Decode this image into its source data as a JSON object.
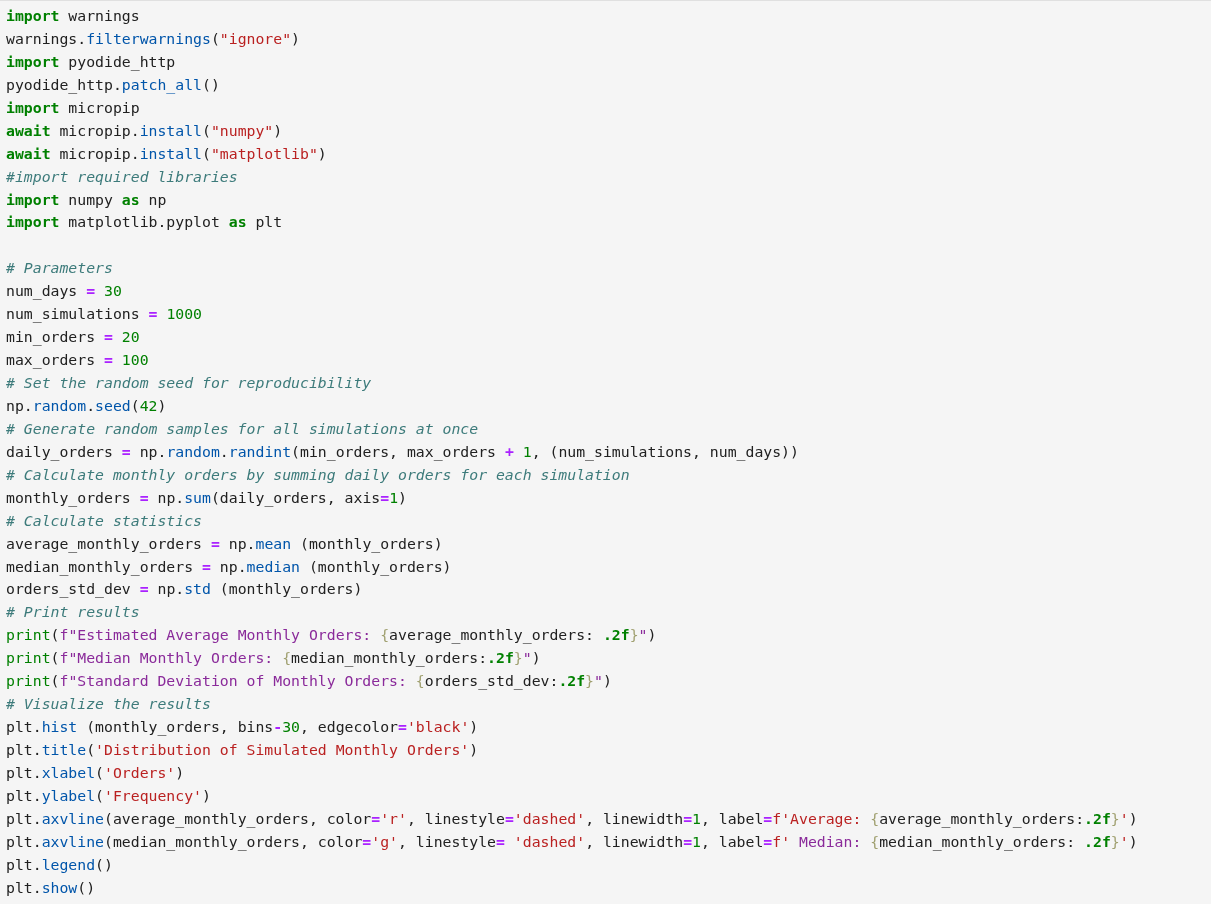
{
  "code_cell": {
    "lines": [
      {
        "kind": "code",
        "tokens": [
          {
            "kind": "kw",
            "text": "import"
          },
          {
            "kind": "name",
            "text": " warnings"
          }
        ]
      },
      {
        "kind": "code",
        "tokens": [
          {
            "kind": "name",
            "text": "warnings."
          },
          {
            "kind": "fn",
            "text": "filterwarnings"
          },
          {
            "kind": "name",
            "text": "("
          },
          {
            "kind": "str",
            "text": "\"ignore\""
          },
          {
            "kind": "name",
            "text": ")"
          }
        ]
      },
      {
        "kind": "code",
        "tokens": [
          {
            "kind": "kw",
            "text": "import"
          },
          {
            "kind": "name",
            "text": " pyodide_http"
          }
        ]
      },
      {
        "kind": "code",
        "tokens": [
          {
            "kind": "name",
            "text": "pyodide_http."
          },
          {
            "kind": "fn",
            "text": "patch_all"
          },
          {
            "kind": "name",
            "text": "()"
          }
        ]
      },
      {
        "kind": "code",
        "tokens": [
          {
            "kind": "kw",
            "text": "import"
          },
          {
            "kind": "name",
            "text": " micropip"
          }
        ]
      },
      {
        "kind": "code",
        "tokens": [
          {
            "kind": "kw",
            "text": "await"
          },
          {
            "kind": "name",
            "text": " micropip."
          },
          {
            "kind": "fn",
            "text": "install"
          },
          {
            "kind": "name",
            "text": "("
          },
          {
            "kind": "str",
            "text": "\"numpy\""
          },
          {
            "kind": "name",
            "text": ")"
          }
        ]
      },
      {
        "kind": "code",
        "tokens": [
          {
            "kind": "kw",
            "text": "await"
          },
          {
            "kind": "name",
            "text": " micropip."
          },
          {
            "kind": "fn",
            "text": "install"
          },
          {
            "kind": "name",
            "text": "("
          },
          {
            "kind": "str",
            "text": "\"matplotlib\""
          },
          {
            "kind": "name",
            "text": ")"
          }
        ]
      },
      {
        "kind": "code",
        "tokens": [
          {
            "kind": "com",
            "text": "#import required libraries"
          }
        ]
      },
      {
        "kind": "code",
        "tokens": [
          {
            "kind": "kw",
            "text": "import"
          },
          {
            "kind": "name",
            "text": " numpy "
          },
          {
            "kind": "kw",
            "text": "as"
          },
          {
            "kind": "name",
            "text": " np"
          }
        ]
      },
      {
        "kind": "code",
        "tokens": [
          {
            "kind": "kw",
            "text": "import"
          },
          {
            "kind": "name",
            "text": " matplotlib.pyplot "
          },
          {
            "kind": "kw",
            "text": "as"
          },
          {
            "kind": "name",
            "text": " plt"
          }
        ]
      },
      {
        "kind": "blank"
      },
      {
        "kind": "code",
        "tokens": [
          {
            "kind": "com",
            "text": "# Parameters"
          }
        ]
      },
      {
        "kind": "code",
        "tokens": [
          {
            "kind": "name",
            "text": "num_days "
          },
          {
            "kind": "op",
            "text": "="
          },
          {
            "kind": "num",
            "text": " 30"
          }
        ]
      },
      {
        "kind": "code",
        "tokens": [
          {
            "kind": "name",
            "text": "num_simulations "
          },
          {
            "kind": "op",
            "text": "="
          },
          {
            "kind": "num",
            "text": " 1000"
          }
        ]
      },
      {
        "kind": "code",
        "tokens": [
          {
            "kind": "name",
            "text": "min_orders "
          },
          {
            "kind": "op",
            "text": "="
          },
          {
            "kind": "num",
            "text": " 20"
          }
        ]
      },
      {
        "kind": "code",
        "tokens": [
          {
            "kind": "name",
            "text": "max_orders "
          },
          {
            "kind": "op",
            "text": "="
          },
          {
            "kind": "num",
            "text": " 100"
          }
        ]
      },
      {
        "kind": "code",
        "tokens": [
          {
            "kind": "com",
            "text": "# Set the random seed for reproducibility"
          }
        ]
      },
      {
        "kind": "code",
        "tokens": [
          {
            "kind": "name",
            "text": "np."
          },
          {
            "kind": "fn",
            "text": "random"
          },
          {
            "kind": "name",
            "text": "."
          },
          {
            "kind": "fn",
            "text": "seed"
          },
          {
            "kind": "name",
            "text": "("
          },
          {
            "kind": "num",
            "text": "42"
          },
          {
            "kind": "name",
            "text": ")"
          }
        ]
      },
      {
        "kind": "code",
        "tokens": [
          {
            "kind": "com",
            "text": "# Generate random samples for all simulations at once"
          }
        ]
      },
      {
        "kind": "code",
        "tokens": [
          {
            "kind": "name",
            "text": "daily_orders "
          },
          {
            "kind": "op",
            "text": "="
          },
          {
            "kind": "name",
            "text": " np."
          },
          {
            "kind": "fn",
            "text": "random"
          },
          {
            "kind": "name",
            "text": "."
          },
          {
            "kind": "fn",
            "text": "randint"
          },
          {
            "kind": "name",
            "text": "(min_orders, max_orders "
          },
          {
            "kind": "op",
            "text": "+"
          },
          {
            "kind": "num",
            "text": " 1"
          },
          {
            "kind": "name",
            "text": ", (num_simulations, num_days))"
          }
        ]
      },
      {
        "kind": "code",
        "tokens": [
          {
            "kind": "com",
            "text": "# Calculate monthly orders by summing daily orders for each simulation"
          }
        ]
      },
      {
        "kind": "code",
        "tokens": [
          {
            "kind": "name",
            "text": "monthly_orders "
          },
          {
            "kind": "op",
            "text": "="
          },
          {
            "kind": "name",
            "text": " np."
          },
          {
            "kind": "fn",
            "text": "sum"
          },
          {
            "kind": "name",
            "text": "(daily_orders, axis"
          },
          {
            "kind": "op",
            "text": "="
          },
          {
            "kind": "num",
            "text": "1"
          },
          {
            "kind": "name",
            "text": ")"
          }
        ]
      },
      {
        "kind": "code",
        "tokens": [
          {
            "kind": "com",
            "text": "# Calculate statistics"
          }
        ]
      },
      {
        "kind": "code",
        "tokens": [
          {
            "kind": "name",
            "text": "average_monthly_orders "
          },
          {
            "kind": "op",
            "text": "="
          },
          {
            "kind": "name",
            "text": " np."
          },
          {
            "kind": "fn",
            "text": "mean"
          },
          {
            "kind": "name",
            "text": " (monthly_orders)"
          }
        ]
      },
      {
        "kind": "code",
        "tokens": [
          {
            "kind": "name",
            "text": "median_monthly_orders "
          },
          {
            "kind": "op",
            "text": "="
          },
          {
            "kind": "name",
            "text": " np."
          },
          {
            "kind": "fn",
            "text": "median"
          },
          {
            "kind": "name",
            "text": " (monthly_orders)"
          }
        ]
      },
      {
        "kind": "code",
        "tokens": [
          {
            "kind": "name",
            "text": "orders_std_dev "
          },
          {
            "kind": "op",
            "text": "="
          },
          {
            "kind": "name",
            "text": " np."
          },
          {
            "kind": "fn",
            "text": "std"
          },
          {
            "kind": "name",
            "text": " (monthly_orders)"
          }
        ]
      },
      {
        "kind": "code",
        "tokens": [
          {
            "kind": "com",
            "text": "# Print results"
          }
        ]
      },
      {
        "kind": "code",
        "tokens": [
          {
            "kind": "builtin",
            "text": "print"
          },
          {
            "kind": "name",
            "text": "("
          },
          {
            "kind": "fs",
            "text": "f\"Estimated Average Monthly Orders: "
          },
          {
            "kind": "brace",
            "text": "{"
          },
          {
            "kind": "name",
            "text": "average_monthly_orders: "
          },
          {
            "kind": "fmt",
            "text": ".2f"
          },
          {
            "kind": "brace",
            "text": "}"
          },
          {
            "kind": "fs",
            "text": "\""
          },
          {
            "kind": "name",
            "text": ")"
          }
        ]
      },
      {
        "kind": "code",
        "tokens": [
          {
            "kind": "builtin",
            "text": "print"
          },
          {
            "kind": "name",
            "text": "("
          },
          {
            "kind": "fs",
            "text": "f\"Median Monthly Orders: "
          },
          {
            "kind": "brace",
            "text": "{"
          },
          {
            "kind": "name",
            "text": "median_monthly_orders:"
          },
          {
            "kind": "fmt",
            "text": ".2f"
          },
          {
            "kind": "brace",
            "text": "}"
          },
          {
            "kind": "fs",
            "text": "\""
          },
          {
            "kind": "name",
            "text": ")"
          }
        ]
      },
      {
        "kind": "code",
        "tokens": [
          {
            "kind": "builtin",
            "text": "print"
          },
          {
            "kind": "name",
            "text": "("
          },
          {
            "kind": "fs",
            "text": "f\"Standard Deviation of Monthly Orders: "
          },
          {
            "kind": "brace",
            "text": "{"
          },
          {
            "kind": "name",
            "text": "orders_std_dev:"
          },
          {
            "kind": "fmt",
            "text": ".2f"
          },
          {
            "kind": "brace",
            "text": "}"
          },
          {
            "kind": "fs",
            "text": "\""
          },
          {
            "kind": "name",
            "text": ")"
          }
        ]
      },
      {
        "kind": "code",
        "tokens": [
          {
            "kind": "com",
            "text": "# Visualize the results"
          }
        ]
      },
      {
        "kind": "code",
        "tokens": [
          {
            "kind": "name",
            "text": "plt."
          },
          {
            "kind": "fn",
            "text": "hist"
          },
          {
            "kind": "name",
            "text": " (monthly_orders, bins"
          },
          {
            "kind": "op",
            "text": "-"
          },
          {
            "kind": "num",
            "text": "30"
          },
          {
            "kind": "name",
            "text": ", edgecolor"
          },
          {
            "kind": "op",
            "text": "="
          },
          {
            "kind": "str",
            "text": "'black'"
          },
          {
            "kind": "name",
            "text": ")"
          }
        ]
      },
      {
        "kind": "code",
        "tokens": [
          {
            "kind": "name",
            "text": "plt."
          },
          {
            "kind": "fn",
            "text": "title"
          },
          {
            "kind": "name",
            "text": "("
          },
          {
            "kind": "str",
            "text": "'Distribution of Simulated Monthly Orders'"
          },
          {
            "kind": "name",
            "text": ")"
          }
        ]
      },
      {
        "kind": "code",
        "tokens": [
          {
            "kind": "name",
            "text": "plt."
          },
          {
            "kind": "fn",
            "text": "xlabel"
          },
          {
            "kind": "name",
            "text": "("
          },
          {
            "kind": "str",
            "text": "'Orders'"
          },
          {
            "kind": "name",
            "text": ")"
          }
        ]
      },
      {
        "kind": "code",
        "tokens": [
          {
            "kind": "name",
            "text": "plt."
          },
          {
            "kind": "fn",
            "text": "ylabel"
          },
          {
            "kind": "name",
            "text": "("
          },
          {
            "kind": "str",
            "text": "'Frequency'"
          },
          {
            "kind": "name",
            "text": ")"
          }
        ]
      },
      {
        "kind": "code",
        "tokens": [
          {
            "kind": "name",
            "text": "plt."
          },
          {
            "kind": "fn",
            "text": "axvline"
          },
          {
            "kind": "name",
            "text": "(average_monthly_orders, color"
          },
          {
            "kind": "op",
            "text": "="
          },
          {
            "kind": "str",
            "text": "'r'"
          },
          {
            "kind": "name",
            "text": ", linestyle"
          },
          {
            "kind": "op",
            "text": "="
          },
          {
            "kind": "str",
            "text": "'dashed'"
          },
          {
            "kind": "name",
            "text": ", linewidth"
          },
          {
            "kind": "op",
            "text": "="
          },
          {
            "kind": "num",
            "text": "1"
          },
          {
            "kind": "name",
            "text": ", label"
          },
          {
            "kind": "op",
            "text": "="
          },
          {
            "kind": "str",
            "text": "f'Average: "
          },
          {
            "kind": "brace",
            "text": "{"
          },
          {
            "kind": "name",
            "text": "average_monthly_orders:"
          },
          {
            "kind": "fmt",
            "text": ".2f"
          },
          {
            "kind": "brace",
            "text": "}"
          },
          {
            "kind": "str",
            "text": "'"
          },
          {
            "kind": "name",
            "text": ")"
          }
        ]
      },
      {
        "kind": "code",
        "tokens": [
          {
            "kind": "name",
            "text": "plt."
          },
          {
            "kind": "fn",
            "text": "axvline"
          },
          {
            "kind": "name",
            "text": "(median_monthly_orders, color"
          },
          {
            "kind": "op",
            "text": "="
          },
          {
            "kind": "str",
            "text": "'g'"
          },
          {
            "kind": "name",
            "text": ", linestyle"
          },
          {
            "kind": "op",
            "text": "="
          },
          {
            "kind": "str",
            "text": " 'dashed'"
          },
          {
            "kind": "name",
            "text": ", linewidth"
          },
          {
            "kind": "op",
            "text": "="
          },
          {
            "kind": "num",
            "text": "1"
          },
          {
            "kind": "name",
            "text": ", label"
          },
          {
            "kind": "op",
            "text": "="
          },
          {
            "kind": "str",
            "text": "f'"
          },
          {
            "kind": "fs",
            "text": " Median: "
          },
          {
            "kind": "brace",
            "text": "{"
          },
          {
            "kind": "name",
            "text": "median_monthly_orders: "
          },
          {
            "kind": "fmt",
            "text": ".2f"
          },
          {
            "kind": "brace",
            "text": "}"
          },
          {
            "kind": "str",
            "text": "'"
          },
          {
            "kind": "name",
            "text": ")"
          }
        ]
      },
      {
        "kind": "code",
        "tokens": [
          {
            "kind": "name",
            "text": "plt."
          },
          {
            "kind": "fn",
            "text": "legend"
          },
          {
            "kind": "name",
            "text": "()"
          }
        ]
      },
      {
        "kind": "code",
        "tokens": [
          {
            "kind": "name",
            "text": "plt."
          },
          {
            "kind": "fn",
            "text": "show"
          },
          {
            "kind": "name",
            "text": "()"
          }
        ]
      }
    ]
  }
}
